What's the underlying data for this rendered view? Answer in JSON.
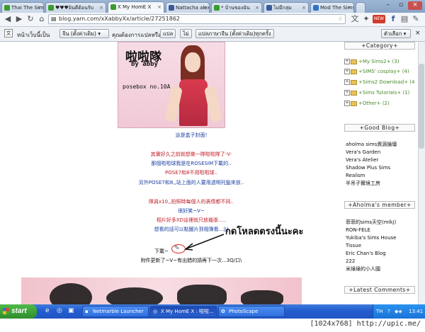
{
  "browser": {
    "tabs": [
      {
        "label": "Thai The Sims",
        "favicon": "#3a9c2c"
      },
      {
        "label": "♥♥♥ยินดีต้อนรับ",
        "favicon": "#3a9c2c"
      },
      {
        "label": "X My HomE X",
        "favicon": "#3a9c2c"
      },
      {
        "label": "Nattacha alex",
        "favicon": "#3b5998"
      },
      {
        "label": "* บ้านของฉัน",
        "favicon": "#3a9c2c"
      },
      {
        "label": "ไม่มีกลุ่ม",
        "favicon": "#3b5998"
      },
      {
        "label": "Mod The Sims",
        "favicon": "#2f73c7"
      }
    ],
    "url": "blog.yam.com/xXabbyXx/article/27251862",
    "translate_bar": {
      "text_this_page": "หน้าเว็บนี้เป็น",
      "language": "จีน (ตั้งค่าเดิม)",
      "question": "คุณต้องการแปลหรือไม่",
      "translate": "แปล",
      "no": "ไม่",
      "always": "แปลภาษาจีน (ตั้งค่าเดิม)ทุกครั้ง",
      "options": "ตัวเลือก"
    },
    "new_badge": "NEW"
  },
  "post": {
    "poster_logo": "啦啦隊",
    "poster_by": "by abby",
    "poster_label": "posebox no.10A",
    "lines": [
      {
        "text": "這是盒子封面!",
        "color": "#1a3fa0"
      },
      {
        "text": "其實好久之前就想做一隊啦啦隊了-V-",
        "color": "#c0202a"
      },
      {
        "text": "那個啦啦球我是在ROSESIM下載的..",
        "color": "#1a3fa0"
      },
      {
        "text": "POSE7和8不用啦啦球..",
        "color": "#c0202a"
      },
      {
        "text": "另外POSE7和8,,站上面的人要用透明托盤來放..",
        "color": "#1a3fa0"
      },
      {
        "text": "隊員x10,,拍照時每個人的表情都不同..",
        "color": "#c0202a"
      },
      {
        "text": "很好笑~V~",
        "color": "#1a3fa0"
      },
      {
        "text": "相片好多XD這裡就只放幾張.....",
        "color": "#c0202a"
      },
      {
        "text": "想看的話可以點圖片到相簿看...|||",
        "color": "#1a3fa0"
      }
    ],
    "download_label": "下載~",
    "update_note": "附件更新了~V~有出錯的請再下一次...3Q/口\\",
    "annotation_thai": "กดโหลดตรงนี้นะคะ"
  },
  "sidebar": {
    "category_title": "+Category+",
    "categories": [
      "+My Sims2+ (3)",
      "+SIMS' cosplay+ (4)",
      "+Sims2 Download+ (4",
      "+Sims Tutorials+ (1)",
      "+Other+ (2)"
    ],
    "good_blog_title": "+Good Blog+",
    "good_blogs": [
      "aholma sims資源論壇",
      "Vera's Garden",
      "Vera's Atelier",
      "Shadow Plus Sims",
      "Realism",
      "半吊子爾境工房"
    ],
    "member_title": "+Aholma's member+",
    "members": [
      "菲菲的sims天空(mlkj)",
      "RON-FELE",
      "Yukiba's Sims House",
      "Tissue",
      "Eric Chan's Blog",
      "222",
      "米綠綠的小人國"
    ],
    "latest_title": "+Latest Comments+"
  },
  "taskbar": {
    "start": "start",
    "tasks": [
      "Netmarble Launcher",
      "X My HomE X : 啦啦...",
      "PhotoScape"
    ],
    "lang": "TH",
    "clock": "13:41"
  },
  "resolution_note": "[1024x768] http://upic.me/"
}
